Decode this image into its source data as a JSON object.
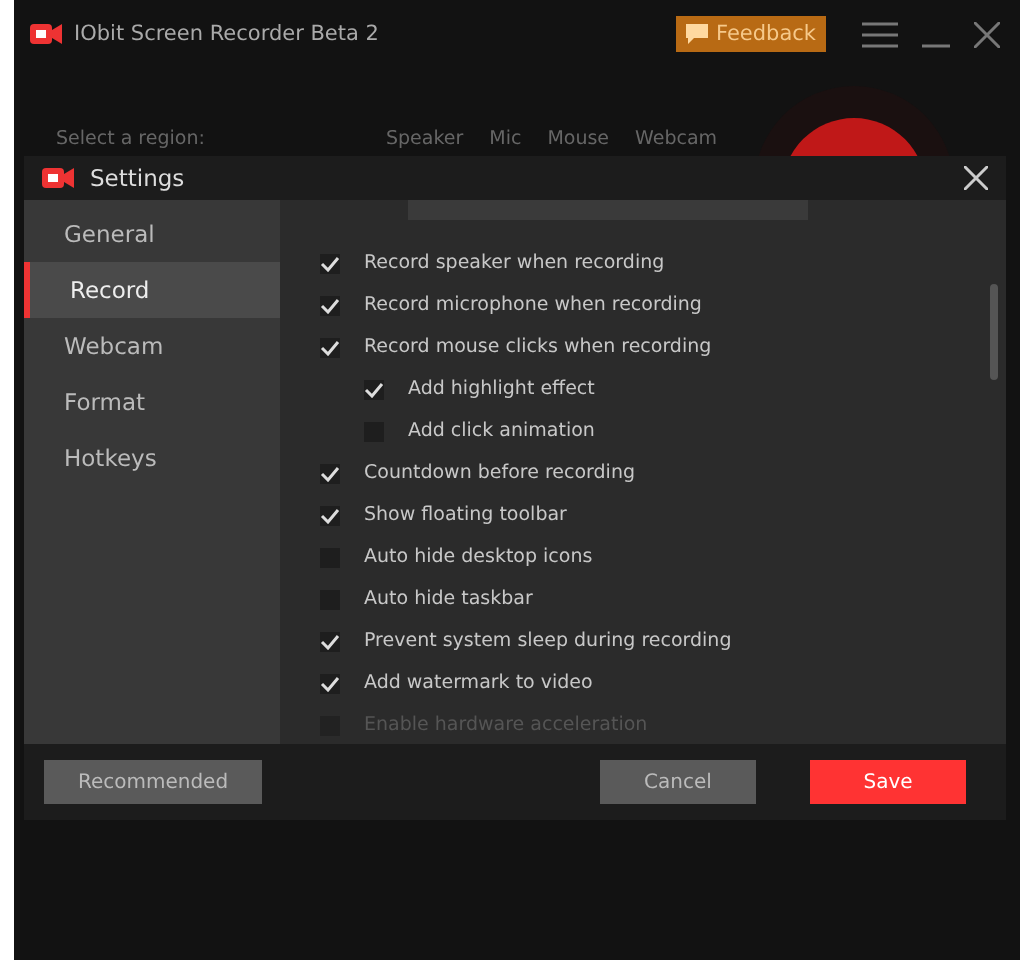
{
  "app": {
    "title": "IObit Screen Recorder Beta 2",
    "feedback": "Feedback"
  },
  "toolbar": {
    "region_label": "Select a region:",
    "sources": [
      "Speaker",
      "Mic",
      "Mouse",
      "Webcam"
    ]
  },
  "dialog": {
    "title": "Settings",
    "sidebar": [
      {
        "label": "General",
        "selected": false
      },
      {
        "label": "Record",
        "selected": true
      },
      {
        "label": "Webcam",
        "selected": false
      },
      {
        "label": "Format",
        "selected": false
      },
      {
        "label": "Hotkeys",
        "selected": false
      }
    ],
    "options": [
      {
        "label": "Record speaker when recording",
        "checked": true,
        "disabled": false
      },
      {
        "label": "Record microphone when recording",
        "checked": true,
        "disabled": false
      },
      {
        "label": "Record mouse clicks when recording",
        "checked": true,
        "disabled": false,
        "children": [
          {
            "label": "Add highlight effect",
            "checked": true,
            "disabled": false
          },
          {
            "label": "Add click animation",
            "checked": false,
            "disabled": false
          }
        ]
      },
      {
        "label": "Countdown before recording",
        "checked": true,
        "disabled": false
      },
      {
        "label": "Show floating toolbar",
        "checked": true,
        "disabled": false
      },
      {
        "label": "Auto hide desktop icons",
        "checked": false,
        "disabled": false
      },
      {
        "label": "Auto hide taskbar",
        "checked": false,
        "disabled": false
      },
      {
        "label": "Prevent system sleep during recording",
        "checked": true,
        "disabled": false
      },
      {
        "label": "Add watermark to video",
        "checked": true,
        "disabled": false
      },
      {
        "label": "Enable hardware acceleration",
        "checked": false,
        "disabled": true
      }
    ],
    "buttons": [
      {
        "label": "Recommended",
        "kind": "secondary"
      },
      {
        "label": "Cancel",
        "kind": "cancel"
      },
      {
        "label": "Save",
        "kind": "primary"
      }
    ]
  }
}
